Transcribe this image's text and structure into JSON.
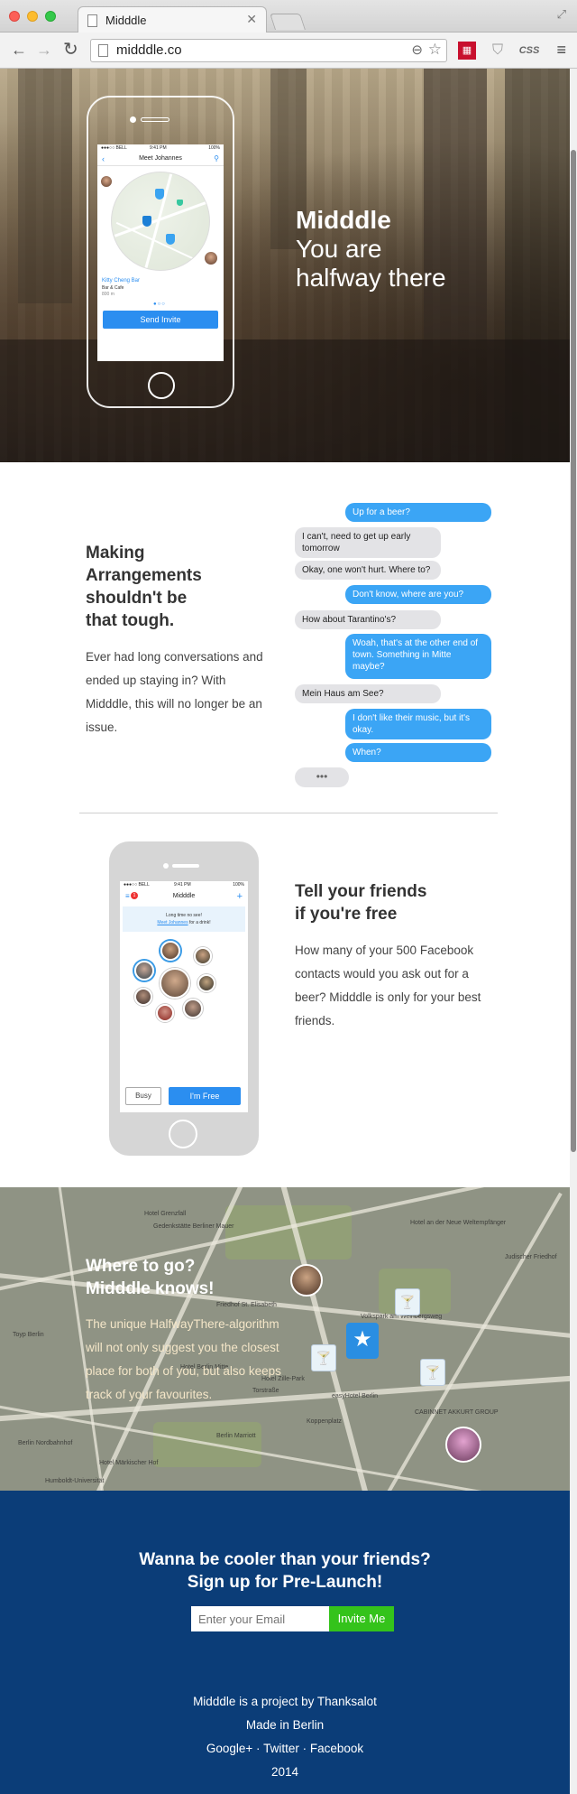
{
  "browser": {
    "tab_title": "Midddle",
    "url": "midddle.co",
    "extension_css_label": "CSS"
  },
  "hero": {
    "title": "Midddle",
    "subtitle_line1": "You are",
    "subtitle_line2": "halfway there",
    "phone": {
      "status_carrier": "●●●○○ BELL",
      "status_time": "9:41 PM",
      "status_battery": "100%",
      "nav_title": "Meet Johannes",
      "place_name": "Kitty Cheng Bar",
      "place_type": "Bar & Cafe",
      "place_distance": "800 m",
      "send_label": "Send Invite"
    }
  },
  "arrangements": {
    "title_lines": [
      "Making",
      "Arrangements",
      "shouldn't be",
      "that tough."
    ],
    "body": "Ever had long conversations and ended up staying in? With Midddle, this will no longer be an issue.",
    "messages": [
      {
        "side": "out",
        "text": "Up for a beer?"
      },
      {
        "side": "in",
        "text": "I can't, need to get up early tomorrow"
      },
      {
        "side": "in",
        "text": "Okay, one won't hurt. Where to?"
      },
      {
        "side": "out",
        "text": "Don't know, where are you?"
      },
      {
        "side": "in",
        "text": "How about Tarantino's?"
      },
      {
        "side": "out",
        "text": "Woah, that's at the other end of town. Something in Mitte maybe?"
      },
      {
        "side": "in",
        "text": "Mein Haus am See?"
      },
      {
        "side": "out",
        "text": "I don't like their music, but it's okay."
      },
      {
        "side": "out",
        "text": "When?"
      }
    ],
    "typing": "•••"
  },
  "friends": {
    "title_lines": [
      "Tell your friends",
      "if you're free"
    ],
    "body": "How many of your 500 Facebook contacts would you ask out for a beer? Midddle is only for your best friends.",
    "phone": {
      "status_carrier": "●●●○○ BELL",
      "status_time": "9:41 PM",
      "status_battery": "100%",
      "nav_title": "Midddle",
      "badge": "1",
      "banner_line1": "Long time no see!",
      "banner_link": "Meet Johannes",
      "banner_line2": " for a drink!",
      "busy_label": "Busy",
      "free_label": "I'm Free"
    }
  },
  "map": {
    "title_lines": [
      "Where to go?",
      "Midddle knows!"
    ],
    "body": "The unique HalfwayThere-algorithm will not only suggest you the closest place for both of you, but also keeps track of your favourites.",
    "labels": [
      "Hotel Grenzfall",
      "Gedenkstätte Berliner Mauer",
      "Friedhof St. Elisabeth",
      "Hotel Berlin Mitte",
      "Volkspark am Weinbergsweg",
      "Torstraße",
      "Hotel Zille-Park",
      "easyHotel Berlin",
      "CABINNET AKKURT GROUP",
      "Koppenplatz",
      "Berlin Marriott",
      "Hotel Märkischer Hof",
      "Toyp Berlin",
      "Berlin Nordbahnhof",
      "Judischer Friedhof",
      "Hotel an der Neue Weltempfänger",
      "Humboldt-Universität"
    ]
  },
  "signup": {
    "title_lines": [
      "Wanna be cooler than your friends?",
      "Sign up for Pre-Launch!"
    ],
    "email_placeholder": "Enter your Email",
    "button_label": "Invite Me"
  },
  "footer": {
    "project_prefix": "Midddle is a project by ",
    "project_by": "Thanksalot",
    "location": "Made in Berlin",
    "link_google": "Google+",
    "sep": " · ",
    "link_twitter": "Twitter",
    "link_facebook": "Facebook",
    "year": "2014"
  }
}
